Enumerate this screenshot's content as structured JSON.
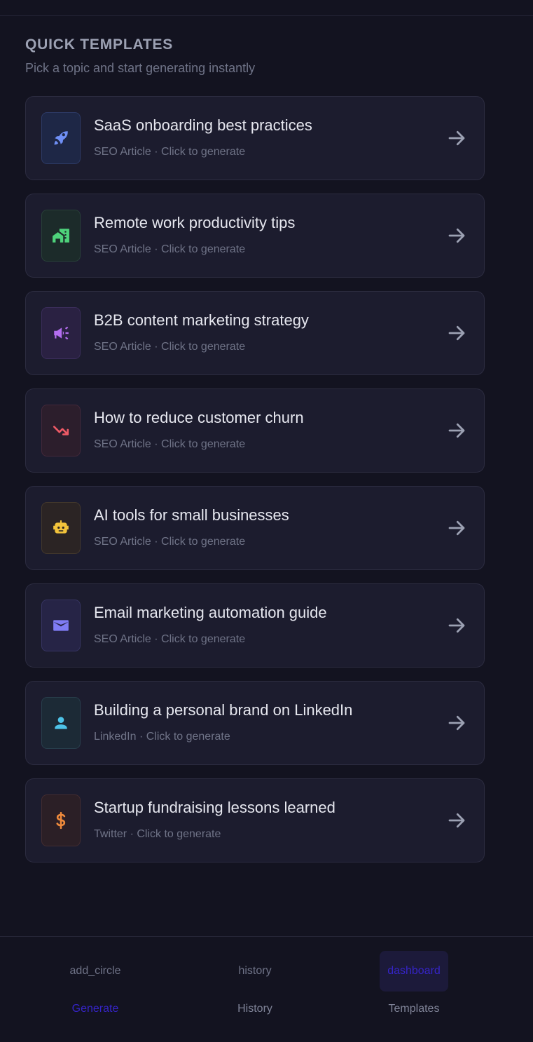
{
  "section": {
    "title": "QUICK TEMPLATES",
    "subtitle": "Pick a topic and start generating instantly"
  },
  "templates": [
    {
      "title": "SaaS onboarding best practices",
      "subtitle": "SEO Article · Click to generate",
      "icon": "rocket-icon",
      "icon_color": "#6f8ff5",
      "icon_bg": "#1e2746",
      "icon_border": "#2d3a66"
    },
    {
      "title": "Remote work productivity tips",
      "subtitle": "SEO Article · Click to generate",
      "icon": "home-work-icon",
      "icon_color": "#4ed27b",
      "icon_bg": "#1c2b2a",
      "icon_border": "#284038"
    },
    {
      "title": "B2B content marketing strategy",
      "subtitle": "SEO Article · Click to generate",
      "icon": "campaign-icon",
      "icon_color": "#b46ef0",
      "icon_bg": "#2a2142",
      "icon_border": "#3a2d5a"
    },
    {
      "title": "How to reduce customer churn",
      "subtitle": "SEO Article · Click to generate",
      "icon": "trending-down-icon",
      "icon_color": "#ee5a66",
      "icon_bg": "#2c1e2c",
      "icon_border": "#43283a"
    },
    {
      "title": "AI tools for small businesses",
      "subtitle": "SEO Article · Click to generate",
      "icon": "robot-icon",
      "icon_color": "#f2c33b",
      "icon_bg": "#2b2424",
      "icon_border": "#43382c"
    },
    {
      "title": "Email marketing automation guide",
      "subtitle": "SEO Article · Click to generate",
      "icon": "mail-icon",
      "icon_color": "#7f7cf4",
      "icon_bg": "#262446",
      "icon_border": "#363462"
    },
    {
      "title": "Building a personal brand on LinkedIn",
      "subtitle": "LinkedIn · Click to generate",
      "icon": "person-icon",
      "icon_color": "#4ec3e8",
      "icon_bg": "#1c2a36",
      "icon_border": "#283e4c"
    },
    {
      "title": "Startup fundraising lessons learned",
      "subtitle": "Twitter · Click to generate",
      "icon": "dollar-icon",
      "icon_color": "#ef8a3c",
      "icon_bg": "#2b1f26",
      "icon_border": "#432c30"
    }
  ],
  "nav": [
    {
      "icon_text": "add_circle",
      "label": "Generate",
      "icon_active": false,
      "label_active": true
    },
    {
      "icon_text": "history",
      "label": "History",
      "icon_active": false,
      "label_active": false
    },
    {
      "icon_text": "dashboard",
      "label": "Templates",
      "icon_active": true,
      "label_active": false
    }
  ],
  "colors": {
    "background": "#131320",
    "card": "#1c1c2e",
    "accent": "#3524c6"
  }
}
